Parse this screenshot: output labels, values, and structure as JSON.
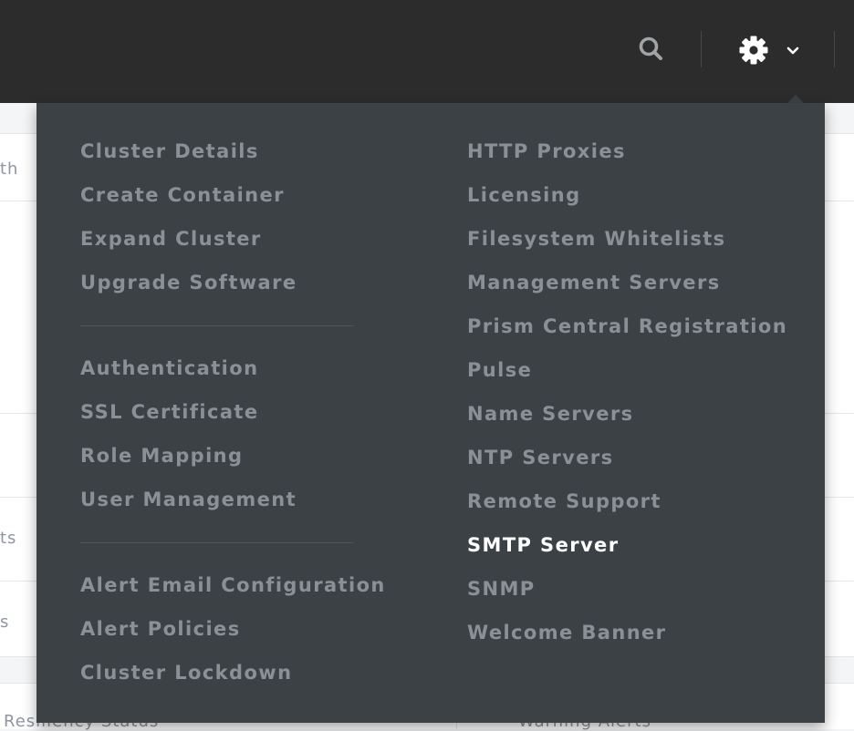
{
  "header": {
    "search_icon": "search-icon",
    "settings_icon": "gear-icon",
    "chevron_icon": "chevron-down-icon"
  },
  "background": {
    "fragments": [
      "th",
      "ts",
      "s",
      "Resiliency Status",
      "Warning Alerts"
    ]
  },
  "menu": {
    "left_groups": [
      [
        "Cluster Details",
        "Create Container",
        "Expand Cluster",
        "Upgrade Software"
      ],
      [
        "Authentication",
        "SSL Certificate",
        "Role Mapping",
        "User Management"
      ],
      [
        "Alert Email Configuration",
        "Alert Policies",
        "Cluster Lockdown"
      ]
    ],
    "right_items": [
      "HTTP Proxies",
      "Licensing",
      "Filesystem Whitelists",
      "Management Servers",
      "Prism Central Registration",
      "Pulse",
      "Name Servers",
      "NTP Servers",
      "Remote Support",
      "SMTP Server",
      "SNMP",
      "Welcome Banner"
    ],
    "active_item": "SMTP Server"
  },
  "colors": {
    "topbar": "#2b2c2b",
    "menu_bg": "#3b4144",
    "menu_text": "#8a9196",
    "menu_active": "#ffffff"
  }
}
